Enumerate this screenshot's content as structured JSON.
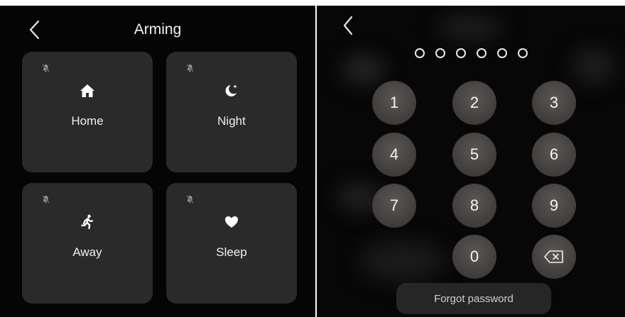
{
  "arming": {
    "title": "Arming",
    "modes": [
      {
        "label": "Home",
        "icon": "home-icon"
      },
      {
        "label": "Night",
        "icon": "moon-icon"
      },
      {
        "label": "Away",
        "icon": "running-person-icon"
      },
      {
        "label": "Sleep",
        "icon": "heart-icon"
      }
    ],
    "mute_icon": "bell-off-icon"
  },
  "keypad": {
    "pin_length": 6,
    "keys": [
      "1",
      "2",
      "3",
      "4",
      "5",
      "6",
      "7",
      "8",
      "9",
      "0"
    ],
    "backspace_icon": "backspace-icon",
    "forgot_label": "Forgot password"
  },
  "colors": {
    "tile_bg": "#2a2a2a",
    "panel_bg": "#050505",
    "key_bg": "#4a4746"
  }
}
